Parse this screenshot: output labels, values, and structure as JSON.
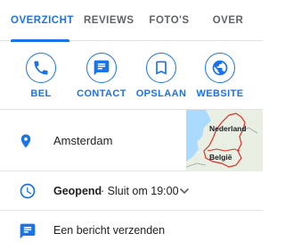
{
  "tabs": [
    {
      "label": "OVERZICHT",
      "active": true
    },
    {
      "label": "REVIEWS",
      "active": false
    },
    {
      "label": "FOTO'S",
      "active": false
    },
    {
      "label": "OVER",
      "active": false
    }
  ],
  "actions": [
    {
      "label": "BEL",
      "icon": "phone-icon"
    },
    {
      "label": "CONTACT",
      "icon": "message-icon"
    },
    {
      "label": "OPSLAAN",
      "icon": "bookmark-icon"
    },
    {
      "label": "WEBSITE",
      "icon": "globe-icon"
    }
  ],
  "address": {
    "text": "Amsterdam",
    "icon": "location-pin-icon",
    "map_labels": {
      "country_1": "Nederland",
      "country_2": "België"
    }
  },
  "hours": {
    "status": "Geopend",
    "closes": "· Sluit om 19:00",
    "icon": "clock-icon",
    "expand_icon": "chevron-down-icon"
  },
  "message": {
    "text": "Een bericht verzenden",
    "icon": "chat-icon"
  },
  "colors": {
    "accent": "#1a73e8",
    "text": "#202124",
    "muted": "#5f6368",
    "divider": "#e3e3e3",
    "map_water": "#aadaff",
    "map_land": "#e9efe3",
    "map_border": "#d93025"
  }
}
